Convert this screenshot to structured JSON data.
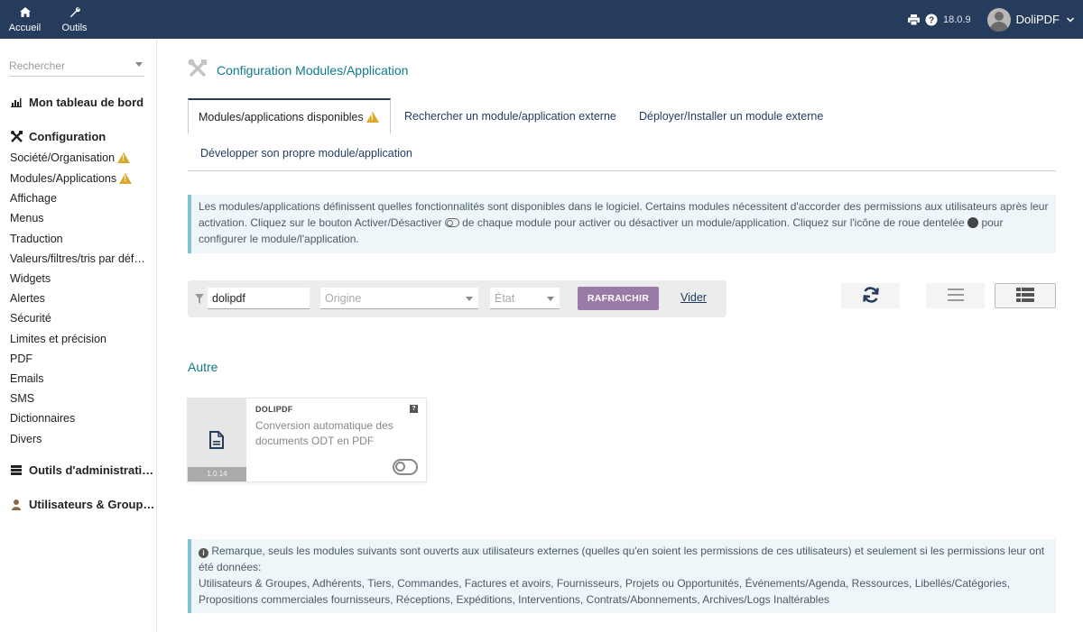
{
  "topbar": {
    "nav": [
      {
        "label": "Accueil",
        "icon": "home-icon"
      },
      {
        "label": "Outils",
        "icon": "wrench-icon"
      }
    ],
    "version": "18.0.9",
    "username": "DoliPDF"
  },
  "sidebar": {
    "search_placeholder": "Rechercher",
    "dashboard_label": "Mon tableau de bord",
    "configuration_label": "Configuration",
    "items": [
      "Société/Organisation",
      "Modules/Applications",
      "Affichage",
      "Menus",
      "Traduction",
      "Valeurs/filtres/tris par déf…",
      "Widgets",
      "Alertes",
      "Sécurité",
      "Limites et précision",
      "PDF",
      "Emails",
      "SMS",
      "Dictionnaires",
      "Divers"
    ],
    "admin_tools_label": "Outils d'administrati…",
    "users_groups_label": "Utilisateurs & Group…"
  },
  "page": {
    "title": "Configuration Modules/Application",
    "tabs": [
      "Modules/applications disponibles",
      "Rechercher un module/application externe",
      "Déployer/Installer un module externe",
      "Développer son propre module/application"
    ]
  },
  "info": {
    "part1": "Les modules/applications définissent quelles fonctionnalités sont disponibles dans le logiciel. Certains modules nécessitent d'accorder des permissions aux utilisateurs après leur activation. Cliquez sur le bouton Activer/Désactiver ",
    "part2": " de chaque module pour activer ou désactiver un module/application. Cliquez sur l'icône de roue dentelée ",
    "part3": " pour configurer le module/l'application."
  },
  "filter": {
    "search_value": "dolipdf",
    "origin_placeholder": "Origine",
    "state_placeholder": "État",
    "refresh_label": "RAFRAICHIR",
    "clear_label": "Vider"
  },
  "group": {
    "title": "Autre",
    "modules": [
      {
        "name": "DOLIPDF",
        "description": "Conversion automatique des documents ODT en PDF",
        "version": "1.0.14",
        "help": "?"
      }
    ]
  },
  "note": {
    "line1": "Remarque, seuls les modules suivants sont ouverts aux utilisateurs externes (quelles qu'en soient les permissions de ces utilisateurs) et seulement si les permissions leur ont été données:",
    "line2": "Utilisateurs & Groupes, Adhérents, Tiers, Commandes, Factures et avoirs, Fournisseurs, Projets ou Opportunités, Événements/Agenda, Ressources, Libellés/Catégories, Propositions commerciales fournisseurs, Réceptions, Expéditions, Interventions, Contrats/Abonnements, Archives/Logs Inaltérables"
  },
  "colors": {
    "topbar": "#263c5c",
    "accent_teal": "#0f7a8a",
    "warning": "#d9a92b",
    "refresh_button": "#9a7aa6"
  }
}
